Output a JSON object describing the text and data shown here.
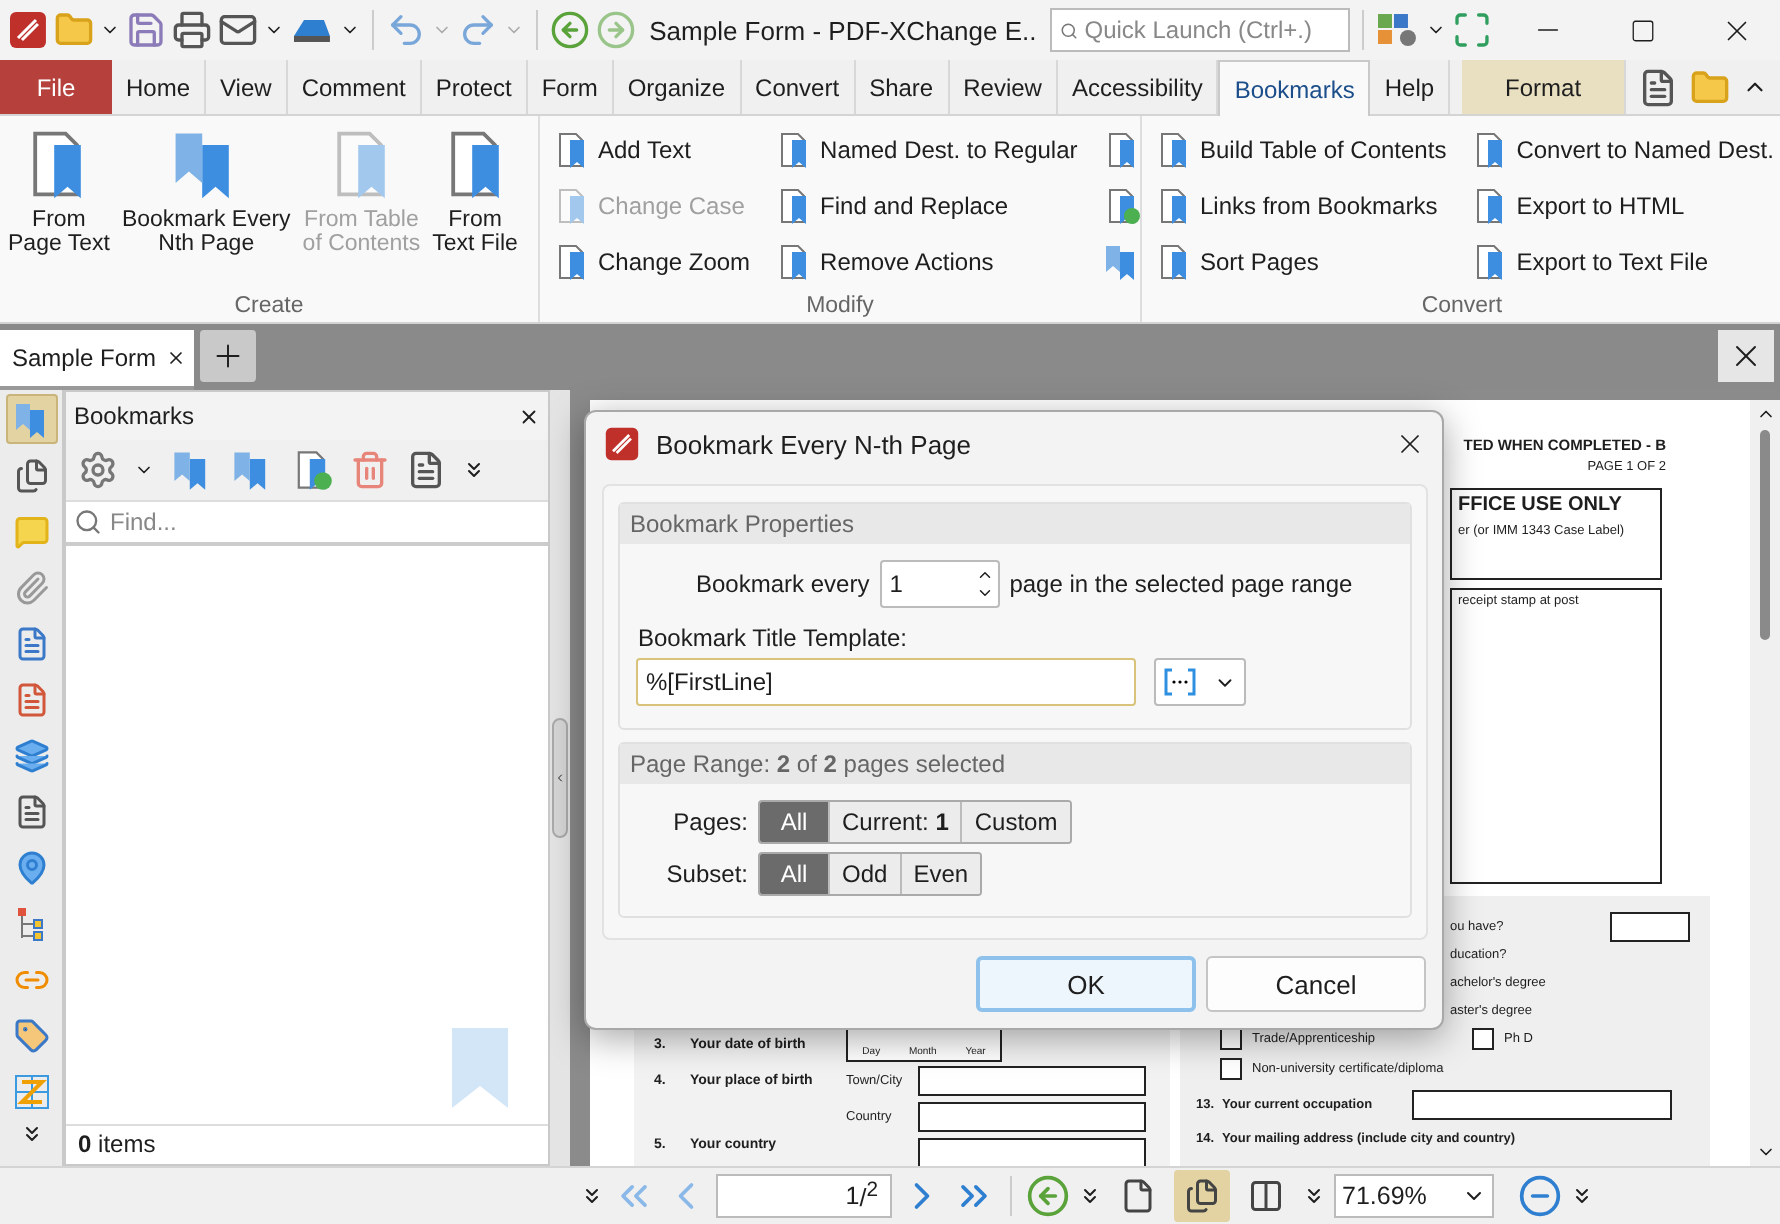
{
  "window": {
    "title": "Sample Form - PDF-XChange E..",
    "quick_launch": {
      "placeholder": "Quick Launch (Ctrl+.)"
    }
  },
  "ribbon_tabs": [
    {
      "label": "File",
      "kind": "file",
      "selected": false
    },
    {
      "label": "Home",
      "kind": "tab",
      "selected": false
    },
    {
      "label": "View",
      "kind": "tab",
      "selected": false
    },
    {
      "label": "Comment",
      "kind": "tab",
      "selected": false
    },
    {
      "label": "Protect",
      "kind": "tab",
      "selected": false
    },
    {
      "label": "Form",
      "kind": "tab",
      "selected": false
    },
    {
      "label": "Organize",
      "kind": "tab",
      "selected": false
    },
    {
      "label": "Convert",
      "kind": "tab",
      "selected": false
    },
    {
      "label": "Share",
      "kind": "tab",
      "selected": false
    },
    {
      "label": "Review",
      "kind": "tab",
      "selected": false
    },
    {
      "label": "Accessibility",
      "kind": "tab",
      "selected": false
    },
    {
      "label": "Bookmarks",
      "kind": "tab",
      "selected": true
    },
    {
      "label": "Help",
      "kind": "tab",
      "selected": false
    },
    {
      "label": "Format",
      "kind": "context",
      "selected": false
    }
  ],
  "ribbon_groups": [
    {
      "label": "Create",
      "kind": "large",
      "buttons": [
        {
          "lines": [
            "From",
            "Page Text"
          ],
          "disabled": false
        },
        {
          "lines": [
            "Bookmark Every",
            "Nth Page"
          ],
          "disabled": false
        },
        {
          "lines": [
            "From Table",
            "of Contents"
          ],
          "disabled": true
        },
        {
          "lines": [
            "From",
            "Text File"
          ],
          "disabled": false
        }
      ]
    },
    {
      "label": "Modify",
      "kind": "small",
      "columns": [
        [
          {
            "label": "Add Text",
            "disabled": false
          },
          {
            "label": "Change Case",
            "disabled": true
          },
          {
            "label": "Change Zoom",
            "disabled": false
          }
        ],
        [
          {
            "label": "Named Dest. to Regular",
            "disabled": false
          },
          {
            "label": "Find and Replace",
            "disabled": false
          },
          {
            "label": "Remove Actions",
            "disabled": false
          }
        ],
        [
          {
            "disabled": false
          },
          {
            "disabled": false
          },
          {
            "disabled": false
          }
        ]
      ]
    },
    {
      "label": "Convert",
      "kind": "small",
      "columns": [
        [
          {
            "label": "Build Table of Contents",
            "disabled": false
          },
          {
            "label": "Links from Bookmarks",
            "disabled": false
          },
          {
            "label": "Sort Pages",
            "disabled": false
          }
        ],
        [
          {
            "label": "Convert to Named Dest.",
            "disabled": false
          },
          {
            "label": "Export to HTML",
            "disabled": false
          },
          {
            "label": "Export to Text File",
            "disabled": false
          }
        ]
      ]
    }
  ],
  "doc_tabs": [
    {
      "label": "Sample Form",
      "selected": true
    }
  ],
  "sidebar_tools": [
    {
      "selected": true
    },
    {
      "selected": false
    },
    {
      "selected": false
    },
    {
      "selected": false
    },
    {
      "selected": false
    },
    {
      "selected": false
    },
    {
      "selected": false
    },
    {
      "selected": false
    },
    {
      "selected": false
    },
    {
      "selected": false
    },
    {
      "selected": false
    },
    {
      "selected": false
    },
    {
      "selected": false
    }
  ],
  "bookmarks_panel": {
    "title": "Bookmarks",
    "search": {
      "placeholder": "Find..."
    },
    "footer": "**0** items"
  },
  "document": {
    "header": "TED WHEN COMPLETED - B",
    "page_label": "PAGE 1 OF 2",
    "office_box": {
      "title": "FFICE USE ONLY",
      "note": "er (or IMM 1343 Case Label)"
    },
    "stamp_box": "receipt stamp at post",
    "questions": [
      "ou have?",
      "ducation?"
    ],
    "degree_options": [
      "achelor's degree",
      "aster's degree"
    ],
    "checkbox_options": [
      {
        "label": "Trade/Apprenticeship",
        "checked": false
      },
      {
        "label": "Ph D",
        "checked": false
      },
      {
        "label": "Non-university certificate/diploma",
        "checked": false
      }
    ],
    "right_fields": [
      {
        "number": "13.",
        "label": "Your current occupation"
      },
      {
        "number": "14.",
        "label": "Your mailing address (include city and country)"
      }
    ],
    "left_fields": [
      {
        "number": "3.",
        "label": "Your date of birth",
        "kind": "date",
        "parts": [
          "Day",
          "Month",
          "Year"
        ]
      },
      {
        "number": "4.",
        "label": "Your place of birth",
        "kind": "place",
        "subfields": [
          "Town/City",
          "Country"
        ]
      },
      {
        "number": "5.",
        "label": "Your country",
        "kind": "text"
      }
    ]
  },
  "dialog": {
    "title": "Bookmark Every N-th Page",
    "properties": {
      "heading": "Bookmark Properties",
      "every_label": "Bookmark every",
      "every_value": "1",
      "every_suffix": "page in the selected page range",
      "template_label": "Bookmark Title Template:",
      "template_value": "%[FirstLine]"
    },
    "range": {
      "heading": "Page Range: **2** of **2** pages selected",
      "pages_label": "Pages:",
      "pages": [
        {
          "label": "All",
          "selected": true
        },
        {
          "label": "Current: **1**",
          "selected": false
        },
        {
          "label": "Custom",
          "selected": false
        }
      ],
      "subset_label": "Subset:",
      "subset": [
        {
          "label": "All",
          "selected": true
        },
        {
          "label": "Odd",
          "selected": false
        },
        {
          "label": "Even",
          "selected": false
        }
      ]
    },
    "buttons": [
      {
        "label": "OK",
        "kind": "default"
      },
      {
        "label": "Cancel",
        "kind": "normal"
      }
    ]
  },
  "status_bar": {
    "page": {
      "current": "1",
      "total": "/$^{2}$"
    },
    "view_modes": [
      {
        "selected": false
      },
      {
        "selected": true
      },
      {
        "selected": false
      }
    ],
    "zoom": "71.69%"
  }
}
